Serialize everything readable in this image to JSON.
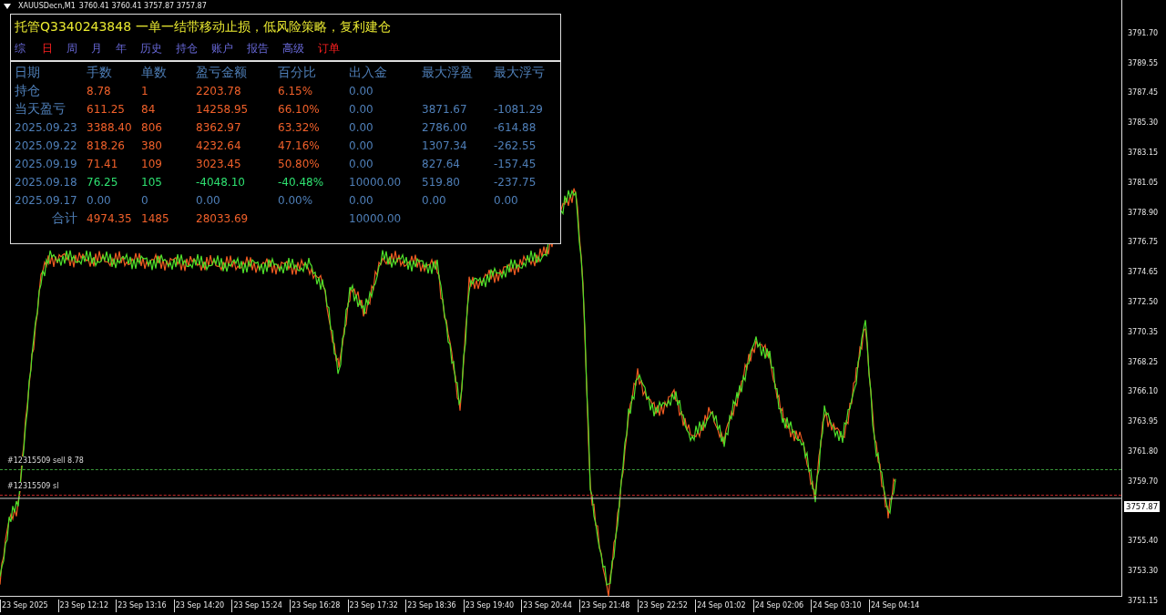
{
  "chart_header": {
    "symbol": "XAUUSDecn,M1",
    "quotes": "3760.41 3760.41 3757.87 3757.87"
  },
  "panel": {
    "title": "托管Q3340243848 一单一结带移动止损，低风险策略，复利建仓",
    "tabs": [
      {
        "label": "综",
        "highlighted": false
      },
      {
        "label": "日",
        "highlighted": true
      },
      {
        "label": "周",
        "highlighted": false
      },
      {
        "label": "月",
        "highlighted": false
      },
      {
        "label": "年",
        "highlighted": false
      },
      {
        "label": "历史",
        "highlighted": false
      },
      {
        "label": "持仓",
        "highlighted": false
      },
      {
        "label": "账户",
        "highlighted": false
      },
      {
        "label": "报告",
        "highlighted": false
      },
      {
        "label": "高级",
        "highlighted": false
      },
      {
        "label": "订单",
        "highlighted": true
      }
    ],
    "table": {
      "columns": [
        "日期",
        "手数",
        "单数",
        "盈亏金额",
        "百分比",
        "出入金",
        "最大浮盈",
        "最大浮亏"
      ],
      "rows": [
        {
          "kind": "summary",
          "negative": false,
          "zero": false,
          "label": "持仓",
          "lots": "8.78",
          "orders": "1",
          "pnl": "2203.78",
          "percent": "6.15%",
          "deposit": "0.00"
        },
        {
          "kind": "summary",
          "negative": false,
          "zero": false,
          "label": "当天盈亏",
          "lots": "611.25",
          "orders": "84",
          "pnl": "14258.95",
          "percent": "66.10%",
          "deposit": "0.00",
          "max_profit": "3871.67",
          "max_loss": "-1081.29"
        },
        {
          "kind": "day",
          "negative": false,
          "zero": false,
          "label": "2025.09.23",
          "lots": "3388.40",
          "orders": "806",
          "pnl": "8362.97",
          "percent": "63.32%",
          "deposit": "0.00",
          "max_profit": "2786.00",
          "max_loss": "-614.88"
        },
        {
          "kind": "day",
          "negative": false,
          "zero": false,
          "label": "2025.09.22",
          "lots": "818.26",
          "orders": "380",
          "pnl": "4232.64",
          "percent": "47.16%",
          "deposit": "0.00",
          "max_profit": "1307.34",
          "max_loss": "-262.55"
        },
        {
          "kind": "day",
          "negative": false,
          "zero": false,
          "label": "2025.09.19",
          "lots": "71.41",
          "orders": "109",
          "pnl": "3023.45",
          "percent": "50.80%",
          "deposit": "0.00",
          "max_profit": "827.64",
          "max_loss": "-157.45"
        },
        {
          "kind": "day",
          "negative": true,
          "zero": false,
          "label": "2025.09.18",
          "lots": "76.25",
          "orders": "105",
          "pnl": "-4048.10",
          "percent": "-40.48%",
          "deposit": "10000.00",
          "max_profit": "519.80",
          "max_loss": "-237.75"
        },
        {
          "kind": "day",
          "negative": false,
          "zero": true,
          "label": "2025.09.17",
          "lots": "0.00",
          "orders": "0",
          "pnl": "0.00",
          "percent": "0.00%",
          "deposit": "0.00",
          "max_profit": "0.00",
          "max_loss": "0.00"
        },
        {
          "kind": "total",
          "negative": false,
          "zero": false,
          "label": "合计",
          "lots": "4974.35",
          "orders": "1485",
          "pnl": "28033.69",
          "deposit": "10000.00"
        }
      ]
    }
  },
  "order_lines": [
    {
      "kind": "sell",
      "label": "#12315509 sell 8.78",
      "color": "#3a9a3a"
    },
    {
      "kind": "sl",
      "label": "#12315509 sl",
      "color": "#c02828"
    }
  ],
  "price_axis": [
    {
      "kind": "tick",
      "text": "3791.70"
    },
    {
      "kind": "tick",
      "text": "3789.55"
    },
    {
      "kind": "tick",
      "text": "3787.45"
    },
    {
      "kind": "tick",
      "text": "3785.30"
    },
    {
      "kind": "tick",
      "text": "3783.15"
    },
    {
      "kind": "tick",
      "text": "3781.05"
    },
    {
      "kind": "tick",
      "text": "3778.90"
    },
    {
      "kind": "tick",
      "text": "3776.75"
    },
    {
      "kind": "tick",
      "text": "3774.65"
    },
    {
      "kind": "tick",
      "text": "3772.50"
    },
    {
      "kind": "tick",
      "text": "3770.35"
    },
    {
      "kind": "tick",
      "text": "3768.25"
    },
    {
      "kind": "tick",
      "text": "3766.10"
    },
    {
      "kind": "tick",
      "text": "3763.95"
    },
    {
      "kind": "tick",
      "text": "3761.80"
    },
    {
      "kind": "tick",
      "text": "3759.70"
    },
    {
      "kind": "current",
      "text": "3757.87"
    },
    {
      "kind": "tick",
      "text": "3755.40"
    },
    {
      "kind": "tick",
      "text": "3753.30"
    },
    {
      "kind": "tick",
      "text": "3751.15"
    }
  ],
  "time_axis": [
    "23 Sep 2025",
    "23 Sep 12:12",
    "23 Sep 13:16",
    "23 Sep 14:20",
    "23 Sep 15:24",
    "23 Sep 16:28",
    "23 Sep 17:32",
    "23 Sep 18:36",
    "23 Sep 19:40",
    "23 Sep 20:44",
    "23 Sep 21:48",
    "23 Sep 22:52",
    "24 Sep 01:02",
    "24 Sep 02:06",
    "24 Sep 03:10",
    "24 Sep 04:14"
  ]
}
